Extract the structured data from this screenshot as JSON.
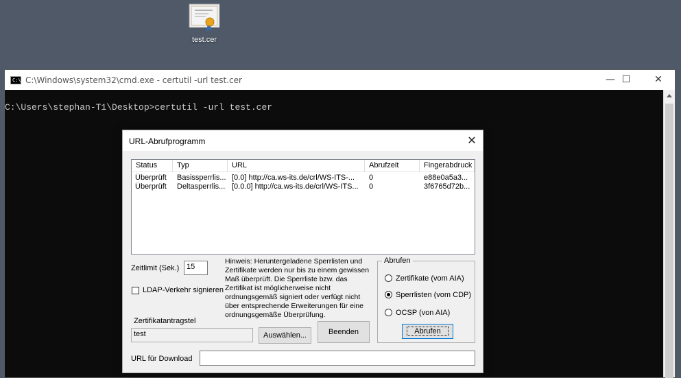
{
  "desktop": {
    "icon_label": "test.cer"
  },
  "cmd": {
    "title": "C:\\Windows\\system32\\cmd.exe - certutil  -url test.cer",
    "line": "C:\\Users\\stephan-T1\\Desktop>certutil -url test.cer",
    "controls": {
      "minimize": "—",
      "maximize": "☐",
      "close": "✕"
    }
  },
  "dialog": {
    "title": "URL-Abrufprogramm",
    "close": "✕",
    "columns": [
      "Status",
      "Typ",
      "URL",
      "Abrufzeit",
      "Fingerabdruck"
    ],
    "rows": [
      [
        "Überprüft",
        "Basissperrlis...",
        "[0.0] http://ca.ws-its.de/crl/WS-ITS-...",
        "0",
        "e88e0a5a3..."
      ],
      [
        "Überprüft",
        "Deltasperrlis...",
        "[0.0.0] http://ca.ws-its.de/crl/WS-ITS...",
        "0",
        "3f6765d72b..."
      ]
    ],
    "timeout_label": "Zeitlimit (Sek.)",
    "timeout_value": "15",
    "ldap_label": "LDAP-Verkehr signieren",
    "hint": "Hinweis: Heruntergeladene Sperrlisten und Zertifikate werden nur bis zu einem gewissen Maß überprüft. Die Sperrliste bzw. das Zertifikat ist möglicherweise nicht ordnungsgemäß signiert oder verfügt nicht über entsprechende Erweiterungen für eine ordnungsgemäße Überprüfung.",
    "cert_request_label": "Zertifikatantragstel",
    "cert_request_value": "test",
    "select_button": "Auswählen...",
    "finish_button": "Beenden",
    "retrieve_group": "Abrufen",
    "radio_certs": "Zertifikate (vom AIA)",
    "radio_crls": "Sperrlisten (vom CDP)",
    "radio_ocsp": "OCSP (von AIA)",
    "retrieve_button": "Abrufen",
    "download_url_label": "URL für Download",
    "download_url_value": ""
  }
}
